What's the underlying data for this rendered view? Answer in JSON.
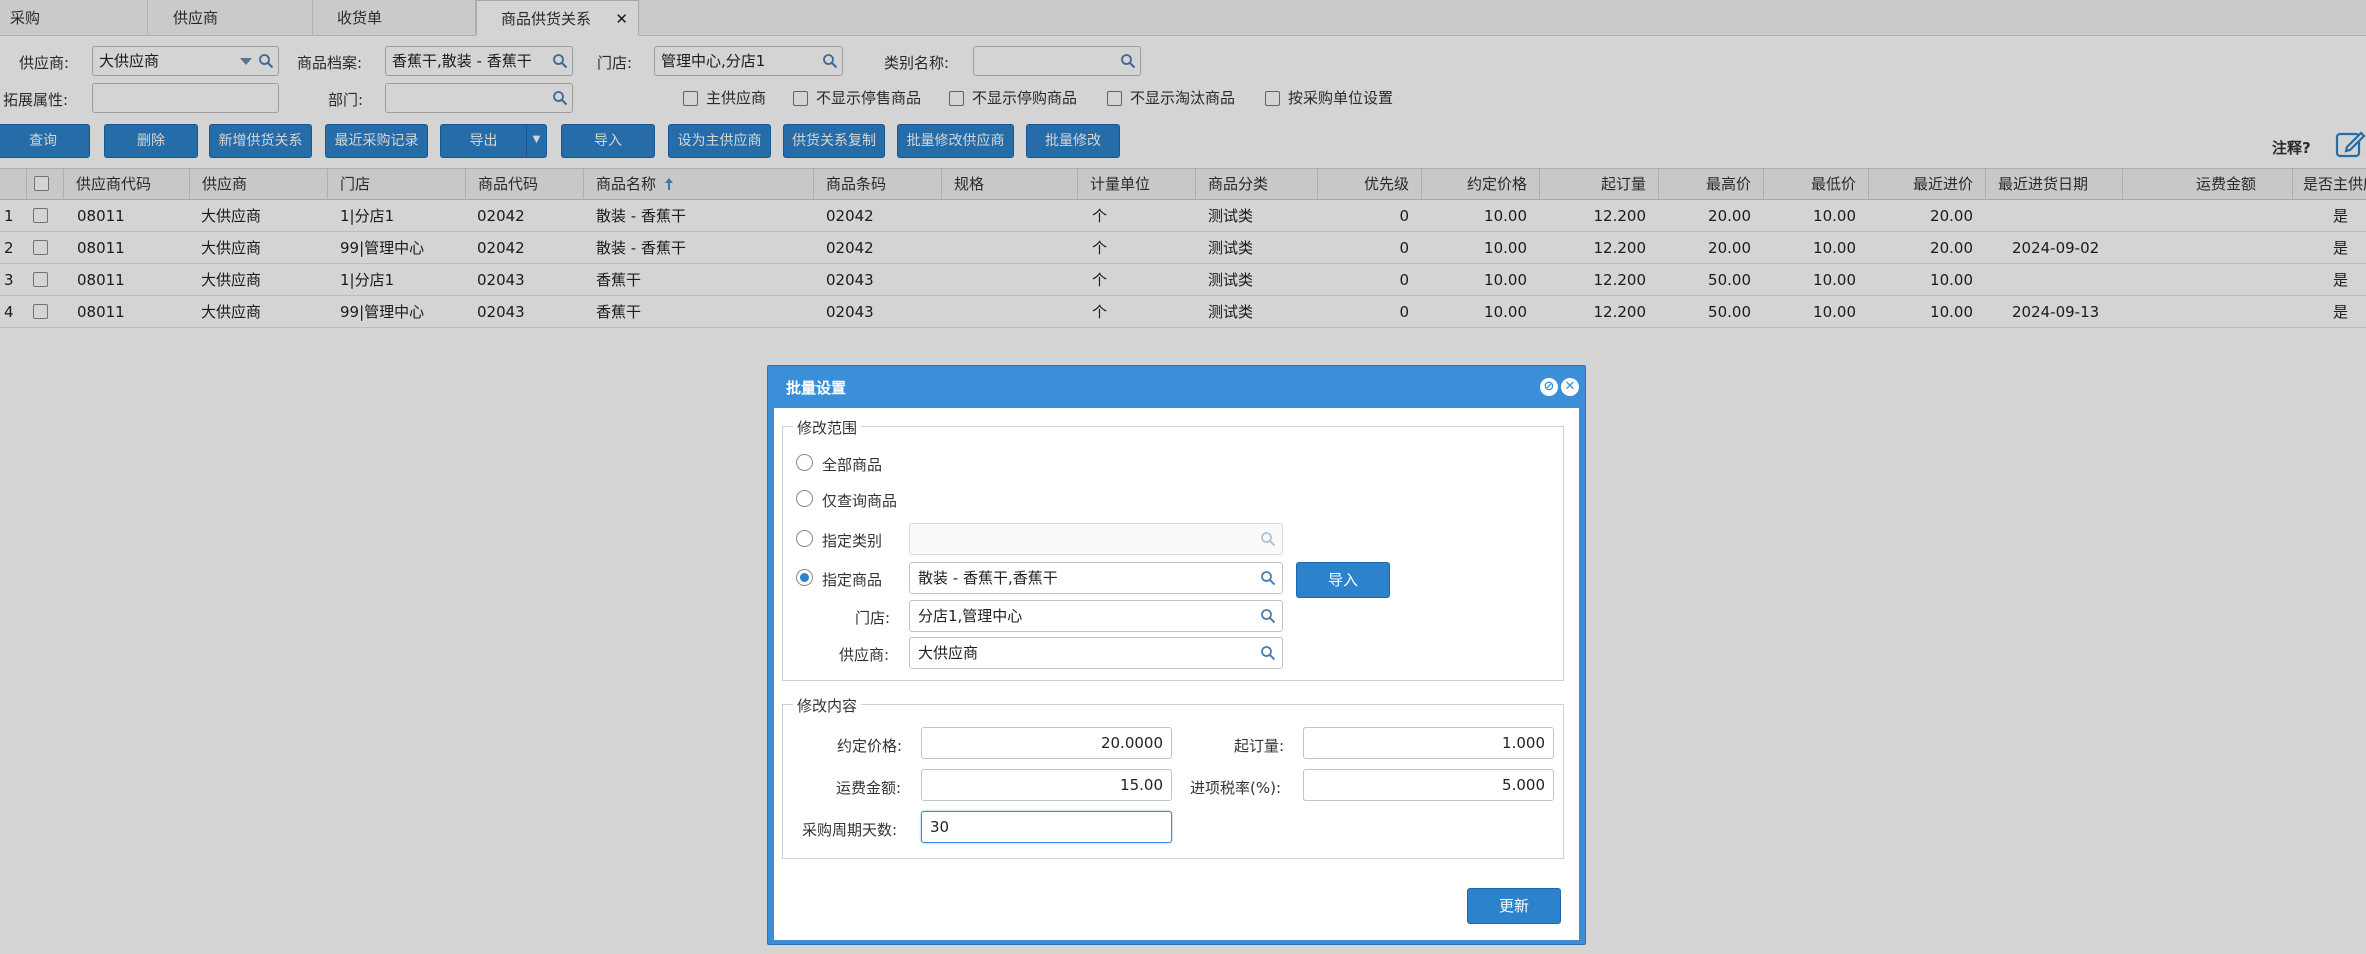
{
  "tabs": [
    "采购",
    "供应商",
    "收货单",
    "商品供货关系"
  ],
  "filters": {
    "supplier_label": "供应商:",
    "supplier_value": "大供应商",
    "product_label": "商品档案:",
    "product_value": "香蕉干,散装 - 香蕉干",
    "store_label": "门店:",
    "store_value": "管理中心,分店1",
    "category_label": "类别名称:",
    "category_value": "",
    "ext_label": "拓展属性:",
    "ext_value": "",
    "dept_label": "部门:",
    "dept_value": "",
    "checkboxes": [
      "主供应商",
      "不显示停售商品",
      "不显示停购商品",
      "不显示淘汰商品",
      "按采购单位设置"
    ]
  },
  "toolbar": {
    "buttons": [
      "查询",
      "删除",
      "新增供货关系",
      "最近采购记录",
      "导出",
      "导入",
      "设为主供应商",
      "供货关系复制",
      "批量修改供应商",
      "批量修改"
    ],
    "note_label": "注释?"
  },
  "grid": {
    "headers": [
      "供应商代码",
      "供应商",
      "门店",
      "商品代码",
      "商品名称",
      "商品条码",
      "规格",
      "计量单位",
      "商品分类",
      "优先级",
      "约定价格",
      "起订量",
      "最高价",
      "最低价",
      "最近进价",
      "最近进货日期",
      "运费金额",
      "是否主供应"
    ],
    "rows": [
      [
        "1",
        "08011",
        "大供应商",
        "1|分店1",
        "02042",
        "散装 - 香蕉干",
        "02042",
        "",
        "个",
        "测试类",
        "0",
        "10.00",
        "12.200",
        "20.00",
        "10.00",
        "20.00",
        "",
        "",
        "是"
      ],
      [
        "2",
        "08011",
        "大供应商",
        "99|管理中心",
        "02042",
        "散装 - 香蕉干",
        "02042",
        "",
        "个",
        "测试类",
        "0",
        "10.00",
        "12.200",
        "20.00",
        "10.00",
        "20.00",
        "2024-09-02",
        "",
        "是"
      ],
      [
        "3",
        "08011",
        "大供应商",
        "1|分店1",
        "02043",
        "香蕉干",
        "02043",
        "",
        "个",
        "测试类",
        "0",
        "10.00",
        "12.200",
        "50.00",
        "10.00",
        "10.00",
        "",
        "",
        "是"
      ],
      [
        "4",
        "08011",
        "大供应商",
        "99|管理中心",
        "02043",
        "香蕉干",
        "02043",
        "",
        "个",
        "测试类",
        "0",
        "10.00",
        "12.200",
        "50.00",
        "10.00",
        "10.00",
        "2024-09-13",
        "",
        "是"
      ]
    ]
  },
  "dialog": {
    "title": "批量设置",
    "scope_legend": "修改范围",
    "radio_all": "全部商品",
    "radio_query": "仅查询商品",
    "radio_category": "指定类别",
    "radio_product": "指定商品",
    "product_value": "散装 - 香蕉干,香蕉干",
    "import_label": "导入",
    "store_label": "门店:",
    "store_value": "分店1,管理中心",
    "supplier_label": "供应商:",
    "supplier_value": "大供应商",
    "content_legend": "修改内容",
    "price_label": "约定价格:",
    "price_value": "20.0000",
    "moq_label": "起订量:",
    "moq_value": "1.000",
    "freight_label": "运费金额:",
    "freight_value": "15.00",
    "tax_label": "进项税率(%):",
    "tax_value": "5.000",
    "cycle_label": "采购周期天数:",
    "cycle_value": "30",
    "update_label": "更新"
  },
  "colors": {
    "accent": "#2d83cb",
    "dialog_header": "#3a8fd8"
  }
}
